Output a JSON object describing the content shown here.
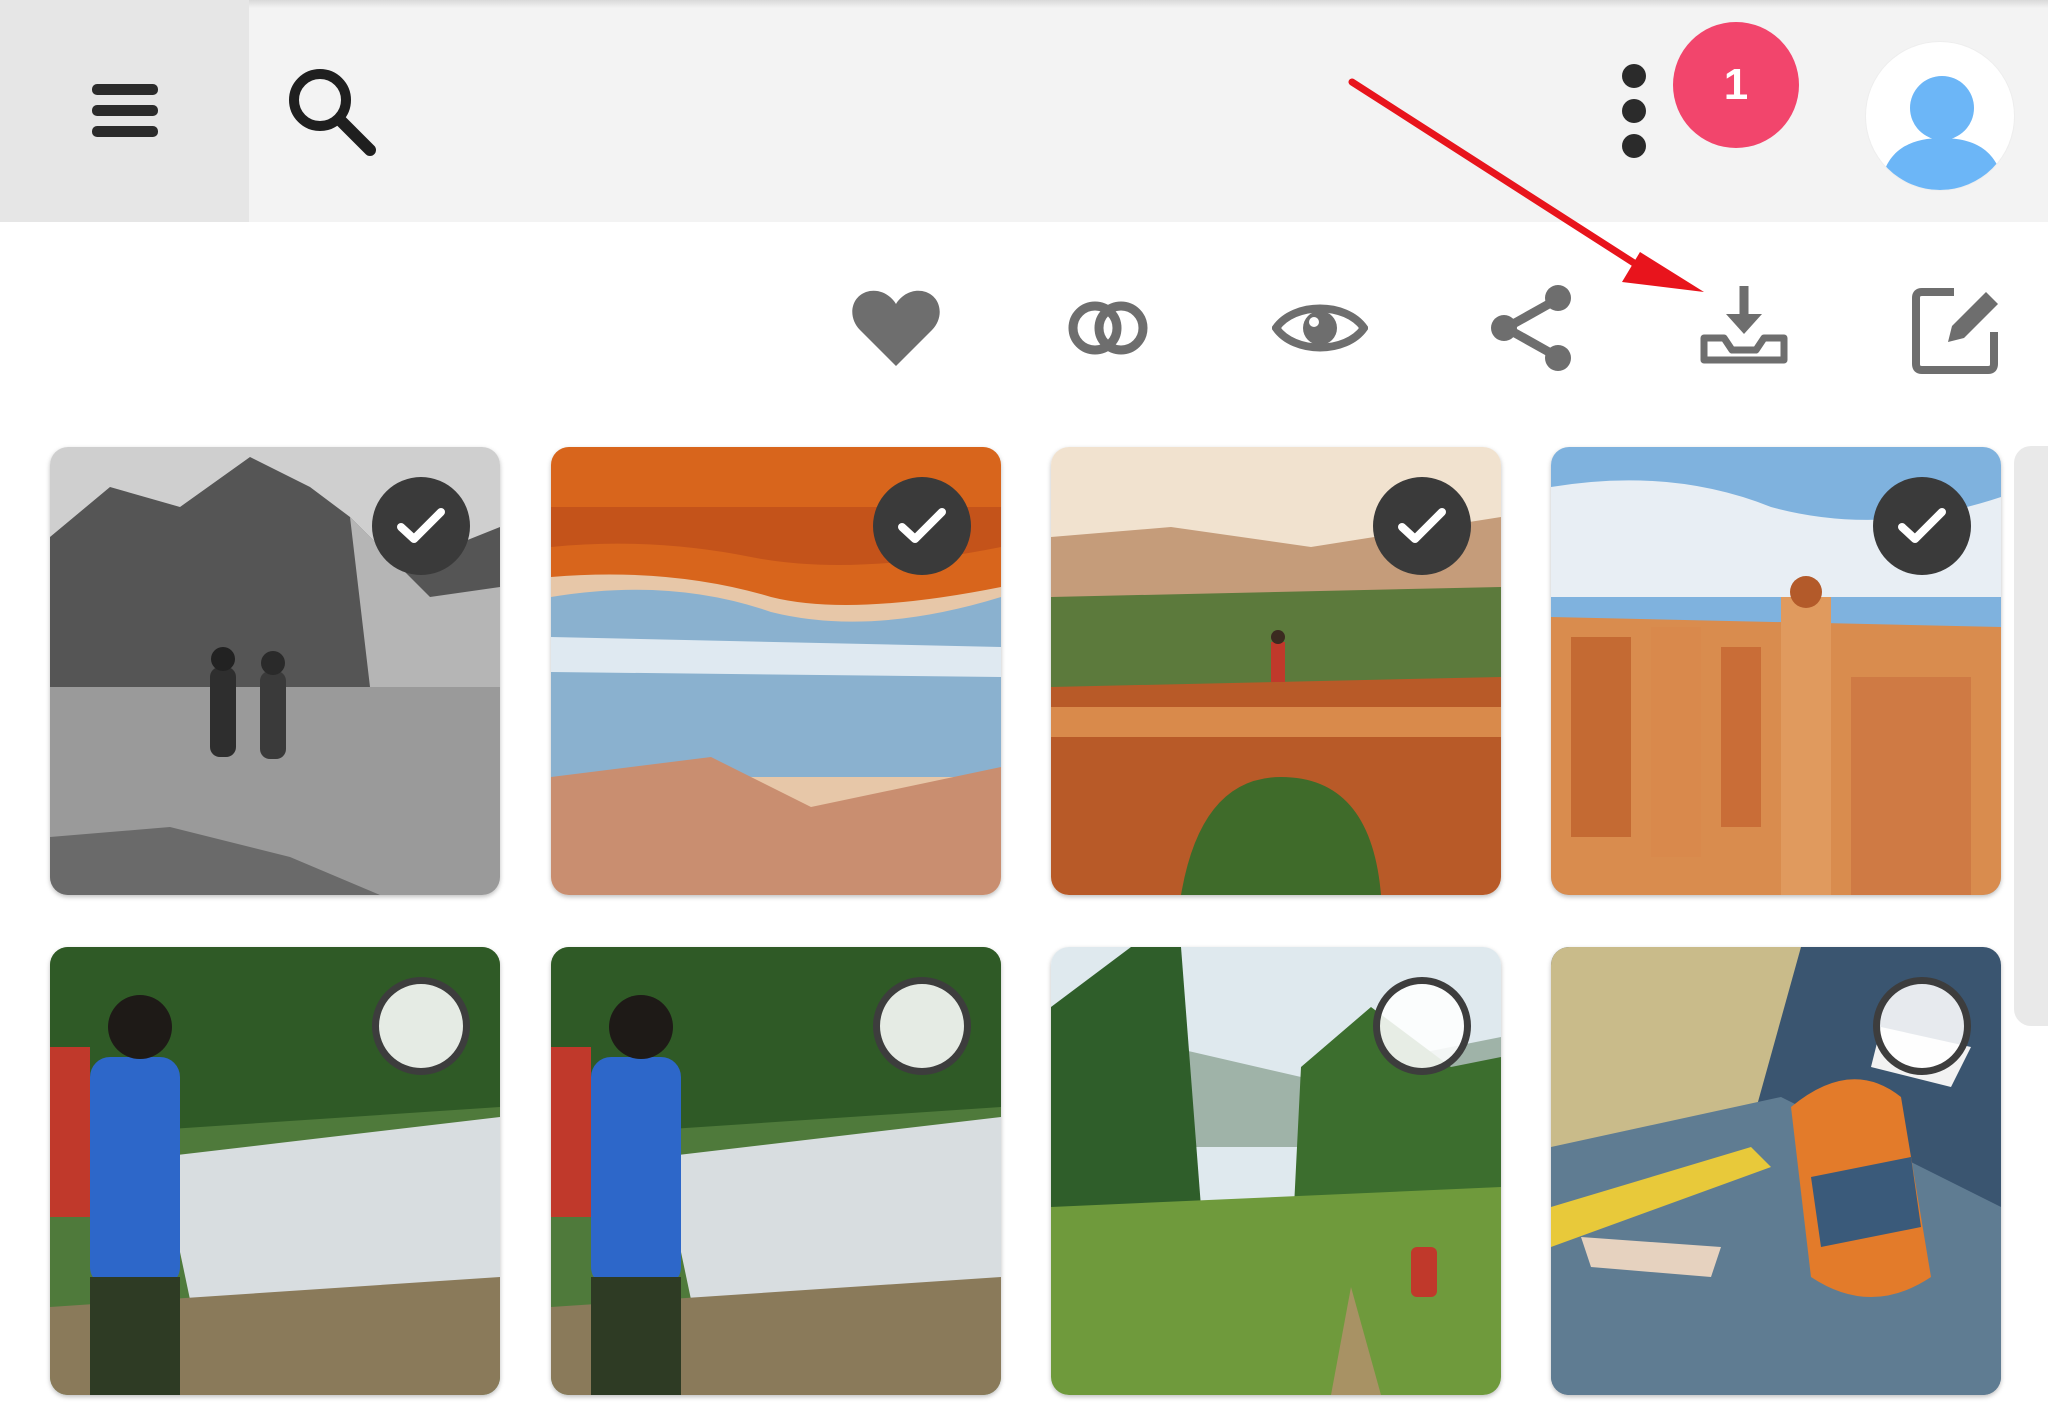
{
  "header": {
    "menu_icon": "hamburger-menu-icon",
    "search_icon": "search-icon",
    "more_icon": "more-vertical-icon",
    "notification_count": "1",
    "avatar_icon": "user-avatar-icon"
  },
  "toolbar": {
    "actions": [
      {
        "icon": "heart-icon"
      },
      {
        "icon": "link-rings-icon"
      },
      {
        "icon": "eye-icon"
      },
      {
        "icon": "share-icon"
      },
      {
        "icon": "download-icon"
      },
      {
        "icon": "edit-icon"
      }
    ]
  },
  "annotation": {
    "pointer": "red-arrow-pointing-to-download"
  },
  "photos": [
    {
      "subject": "couple-at-mountain-lake-bw",
      "selected": true
    },
    {
      "subject": "mesa-arch-sunrise",
      "selected": true
    },
    {
      "subject": "hiker-on-red-rock-arch",
      "selected": true
    },
    {
      "subject": "bryce-canyon-hoodoos",
      "selected": true
    },
    {
      "subject": "hiker-boy-by-forest-stream",
      "selected": false
    },
    {
      "subject": "hiker-boy-by-forest-stream-copy",
      "selected": false
    },
    {
      "subject": "hiker-in-green-meadow",
      "selected": false
    },
    {
      "subject": "traveler-with-backpack-at-train-station",
      "selected": false
    }
  ],
  "colors": {
    "badge": "#f2456c",
    "avatar": "#6cb6f7",
    "icon_gray": "#6e6e6e",
    "arrow": "#e8141c",
    "check_bg": "#3a3a3a"
  }
}
